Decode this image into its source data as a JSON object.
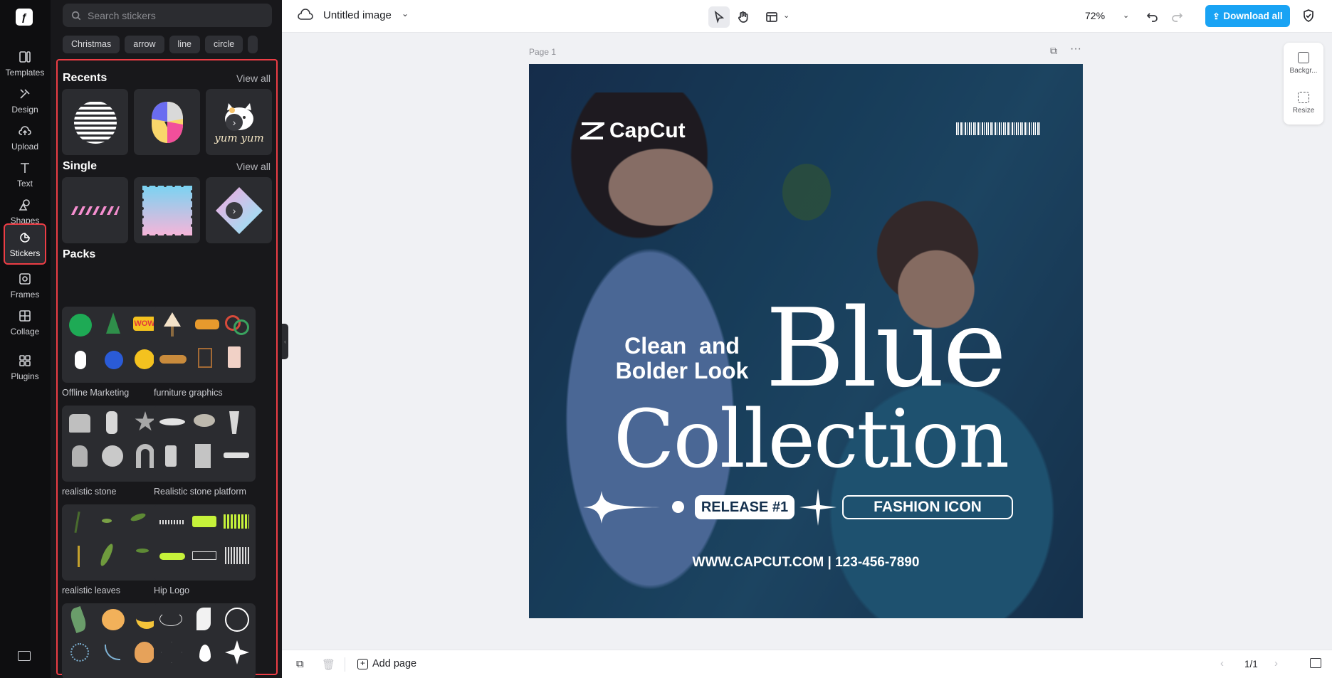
{
  "rail": {
    "items": [
      {
        "label": "Templates"
      },
      {
        "label": "Design"
      },
      {
        "label": "Upload"
      },
      {
        "label": "Text"
      },
      {
        "label": "Shapes"
      },
      {
        "label": "Stickers"
      },
      {
        "label": "Frames"
      },
      {
        "label": "Collage"
      },
      {
        "label": "Plugins"
      }
    ],
    "active_item": "Stickers"
  },
  "panel": {
    "search_placeholder": "Search stickers",
    "chips": [
      "Christmas",
      "arrow",
      "line",
      "circle"
    ],
    "recents": {
      "title": "Recents",
      "view_all": "View all"
    },
    "single": {
      "title": "Single",
      "view_all": "View all"
    },
    "packs": {
      "title": "Packs",
      "items": [
        {
          "label": "Offline Marketing"
        },
        {
          "label": "furniture graphics"
        },
        {
          "label": "realistic stone"
        },
        {
          "label": "Realistic stone platform"
        },
        {
          "label": "realistic leaves"
        },
        {
          "label": "Hip Logo"
        }
      ]
    },
    "recent_sticker_text": "yum yum"
  },
  "topbar": {
    "doc_title": "Untitled image",
    "zoom": "72%",
    "download_label": "Download all"
  },
  "canvas": {
    "page_label": "Page 1",
    "side_tools": [
      {
        "label": "Backgr..."
      },
      {
        "label": "Resize"
      }
    ]
  },
  "design": {
    "brand": "CapCut",
    "tagline_1": "Clean  and",
    "tagline_2": "Bolder Look",
    "headline_1": "Blue",
    "headline_2": "Collection",
    "badge_1": "RELEASE #1",
    "badge_2": "FASHION ICON",
    "contact": "WWW.CAPCUT.COM | 123-456-7890"
  },
  "bottombar": {
    "add_page_label": "Add page",
    "pager": "1/1"
  },
  "colors": {
    "accent": "#19a3f4",
    "highlight": "#ec3d45",
    "panel_bg": "#18181b"
  }
}
